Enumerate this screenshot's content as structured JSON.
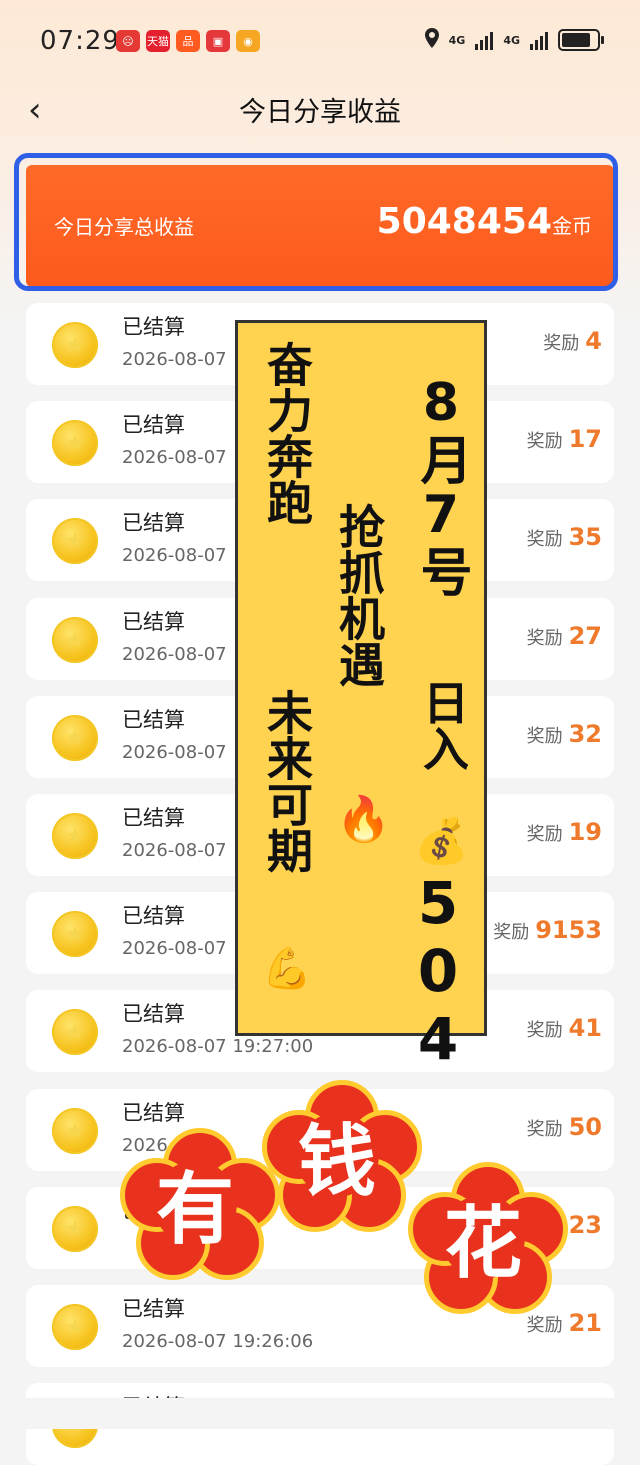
{
  "status_bar": {
    "time": "07:29",
    "apps": [
      {
        "icon": "sad-face-icon",
        "color": "#e53935",
        "glyph": "☹"
      },
      {
        "icon": "tmall-icon",
        "color": "#e5202e",
        "glyph": "天猫"
      },
      {
        "icon": "app-orange-icon",
        "color": "#ff5a1f",
        "glyph": "品"
      },
      {
        "icon": "app-red-square-icon",
        "color": "#e5383b",
        "glyph": "▣"
      },
      {
        "icon": "weibo-icon",
        "color": "#f5a623",
        "glyph": "◉"
      }
    ],
    "network_1": "4G",
    "network_2": "4G"
  },
  "header": {
    "back_glyph": "‹",
    "title": "今日分享收益"
  },
  "summary": {
    "label": "今日分享总收益",
    "value": "5048454",
    "unit": "金币"
  },
  "records": [
    {
      "status": "已结算",
      "time": "2026-08-07",
      "reward_label": "奖励",
      "reward": "4"
    },
    {
      "status": "已结算",
      "time": "2026-08-07",
      "reward_label": "奖励",
      "reward": "17"
    },
    {
      "status": "已结算",
      "time": "2026-08-07",
      "reward_label": "奖励",
      "reward": "35"
    },
    {
      "status": "已结算",
      "time": "2026-08-07",
      "reward_label": "奖励",
      "reward": "27"
    },
    {
      "status": "已结算",
      "time": "2026-08-07",
      "reward_label": "奖励",
      "reward": "32"
    },
    {
      "status": "已结算",
      "time": "2026-08-07",
      "reward_label": "奖励",
      "reward": "19"
    },
    {
      "status": "已结算",
      "time": "2026-08-07",
      "reward_label": "奖励",
      "reward": "9153"
    },
    {
      "status": "已结算",
      "time": "2026-08-07 19:27:00",
      "reward_label": "奖励",
      "reward": "41"
    },
    {
      "status": "已结算",
      "time": "2026-",
      "reward_label": "奖励",
      "reward": "50"
    },
    {
      "status": "已结算",
      "time": "",
      "reward_label": "",
      "reward": "23"
    },
    {
      "status": "已结算",
      "time": "2026-08-07 19:26:06",
      "reward_label": "奖励",
      "reward": "21"
    },
    {
      "status": "已结算",
      "time": "",
      "reward_label": "",
      "reward": ""
    }
  ],
  "poster": {
    "col_left_1": "奋力奔跑",
    "col_left_2": "未来可期",
    "col_left_emoji": "💪",
    "col_mid": "抢抓机遇",
    "col_mid_emoji": "🔥",
    "col_right_1": "8月7号",
    "col_right_2": "日入",
    "col_right_emoji": "💰",
    "col_right_3": "504"
  },
  "sticker": {
    "char_1": "有",
    "char_2": "钱",
    "char_3": "花"
  }
}
